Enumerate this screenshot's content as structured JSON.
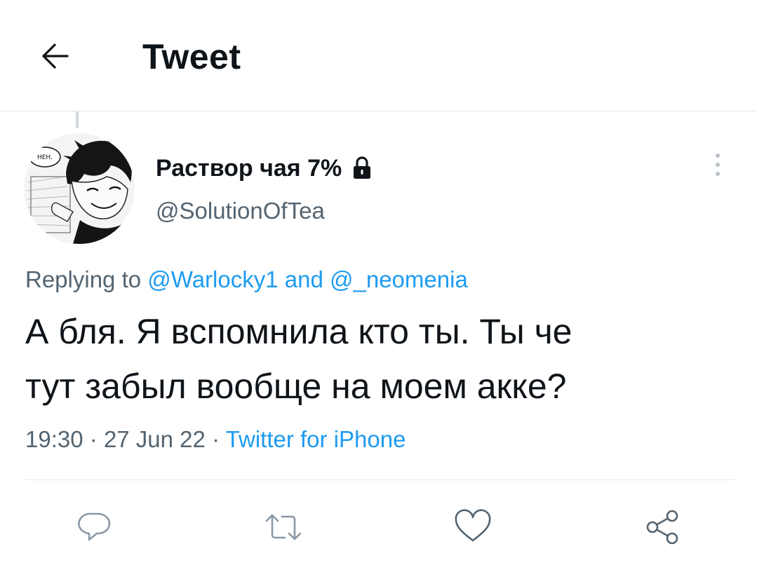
{
  "header": {
    "title": "Tweet",
    "back_icon": "arrow-left-icon"
  },
  "tweet": {
    "author": {
      "display_name": "Раствор чая 7%",
      "handle": "@SolutionOfTea",
      "protected_icon": "lock-icon",
      "avatar_text": "НЕН."
    },
    "replying": {
      "prefix": "Replying to",
      "mention_1": "@Warlocky1",
      "conjunction": "and",
      "mention_2": "@_neomenia"
    },
    "text": "А бля. Я вспомнила кто ты. Ты че\nтут забыл вообще на моем акке?",
    "time": "19:30",
    "separator": "·",
    "date": "27 Jun 22",
    "source": "Twitter for iPhone"
  },
  "actions": [
    {
      "name": "reply",
      "icon": "reply-icon"
    },
    {
      "name": "retweet",
      "icon": "retweet-icon"
    },
    {
      "name": "like",
      "icon": "heart-icon"
    },
    {
      "name": "share",
      "icon": "share-icon"
    }
  ],
  "colors": {
    "text_primary": "#0f1419",
    "text_secondary": "#536471",
    "link": "#1d9bf0",
    "divider": "#e6e9ec"
  }
}
